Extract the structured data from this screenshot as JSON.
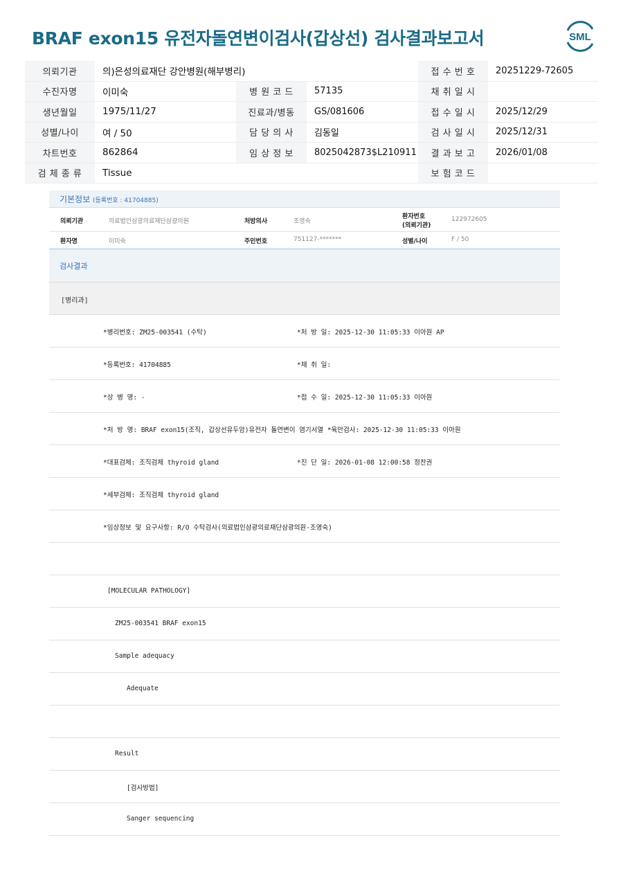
{
  "header": {
    "title": "BRAF exon15 유전자돌연변이검사(갑상선) 검사결과보고서",
    "logo_text": "SML"
  },
  "info_rows": [
    [
      {
        "label": "의뢰기관",
        "value": "의)은성의료재단 강안병원(해부병리)"
      },
      {
        "label": "접 수 번 호",
        "value": "20251229-72605"
      }
    ],
    [
      {
        "label": "수진자명",
        "value": "이미숙"
      },
      {
        "label": "병 원 코 드",
        "value": "57135"
      },
      {
        "label": "채 취 일 시",
        "value": ""
      }
    ],
    [
      {
        "label": "생년월일",
        "value": "1975/11/27"
      },
      {
        "label": "진료과/병동",
        "value": "GS/081606"
      },
      {
        "label": "접 수 일 시",
        "value": "2025/12/29"
      }
    ],
    [
      {
        "label": "성별/나이",
        "value": "여 / 50"
      },
      {
        "label": "담 당 의 사",
        "value": "김동일"
      },
      {
        "label": "검 사 일 시",
        "value": "2025/12/31"
      }
    ],
    [
      {
        "label": "차트번호",
        "value": "862864"
      },
      {
        "label": "임 상 정 보",
        "value": "8025042873$L210911"
      },
      {
        "label": "결 과 보 고",
        "value": "2026/01/08"
      }
    ],
    [
      {
        "label": "검 체 종 류",
        "value": "Tissue"
      },
      {
        "label": "보 험 코 드",
        "value": ""
      }
    ]
  ],
  "basic_info": {
    "title": "기본정보",
    "reg_no": "(등록번호 : 41704885)",
    "req_org_label": "의뢰기관",
    "req_org": "의료법인삼광의료재단삼광의원",
    "doctor_label": "처방의사",
    "doctor": "조영숙",
    "patient_no_label_1": "환자번호",
    "patient_no_label_2": "(의뢰기관)",
    "patient_no": "122972605",
    "patient_label": "환자명",
    "patient": "이미숙",
    "rrn_label": "주민번호",
    "rrn": "751127-*******",
    "sex_age_label": "성별/나이",
    "sex_age": "F / 50"
  },
  "result": {
    "section_title": "검사결과",
    "dept": "[병리과]",
    "lines": [
      {
        "a": "*병리번호: ZM25-003541 (수탁)",
        "b": "*처 방 일: 2025-12-30 11:05:33  이아원 AP"
      },
      {
        "a": "*등록번호: 41704885",
        "b": "*채 취 일:"
      },
      {
        "a": "*상 병 명: -",
        "b": "*접 수 일: 2025-12-30 11:05:33  이아원"
      },
      {
        "a": "*처 방 명: BRAF exon15(조직, 갑상선유두암)유전자 돌연변이 염기서열  *육안검사: 2025-12-30 11:05:33  이아원",
        "b": ""
      },
      {
        "a": "*대표검체: 조직검체 thyroid gland",
        "b": "*진 단 일: 2026-01-08 12:00:58  정찬권"
      },
      {
        "a": "*세부검체: 조직검체 thyroid gland",
        "b": ""
      },
      {
        "a": "*임상정보 및 요구사항: R/O 수탁검사(의료법인삼광의료재단삼광의원-조영숙)",
        "b": ""
      }
    ],
    "molecular": [
      {
        "indent": 1,
        "text": "[MOLECULAR PATHOLOGY]"
      },
      {
        "indent": 2,
        "text": "ZM25-003541     BRAF exon15"
      },
      {
        "indent": 2,
        "text": "Sample adequacy"
      },
      {
        "indent": 3,
        "text": "Adequate"
      },
      {
        "indent": 0,
        "text": ""
      },
      {
        "indent": 2,
        "text": "Result"
      },
      {
        "indent": 3,
        "text": "[검사방법]"
      },
      {
        "indent": 3,
        "text": "Sanger sequencing"
      }
    ]
  }
}
